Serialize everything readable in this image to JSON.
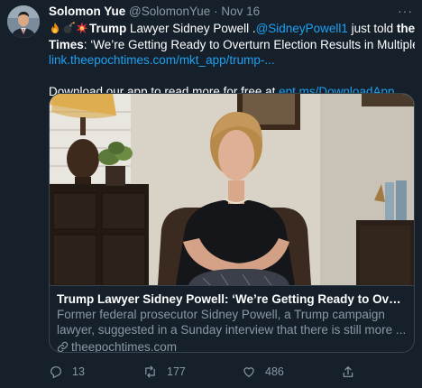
{
  "tweet": {
    "author_name": "Solomon Yue",
    "handle": "@SolomonYue",
    "separator": "·",
    "date": "Nov 16",
    "more_label": "···",
    "text": {
      "trump": "Trump",
      "lawyer": " Lawyer Sidney Powell .",
      "mention": "@SidneyPowell1",
      "just_told": " just told ",
      "epoch": "the Epoch",
      "times": "Times",
      "quote": ": ‘We’re Getting Ready to Overturn Election Results in Multiple States’",
      "link": "link.theepochtimes.com/mkt_app/trump-...",
      "download": "Download our app to read more for free at ",
      "download_link": "ept.ms/DownloadApp"
    },
    "card": {
      "title": "Trump Lawyer Sidney Powell: ‘We’re Getting Ready to Overturn Election ...",
      "description": "Former federal prosecutor Sidney Powell, a Trump campaign lawyer, suggested in a Sunday interview that there is still more ...",
      "domain": "theepochtimes.com"
    },
    "actions": {
      "replies": "13",
      "retweets": "177",
      "likes": "486"
    }
  },
  "colors": {
    "background": "#15202b",
    "link": "#1da1f2",
    "muted": "#8899a6",
    "border": "#38444d"
  },
  "icons": [
    "fire-icon",
    "bomb-icon",
    "explosion-icon",
    "link-icon",
    "reply-icon",
    "retweet-icon",
    "like-icon",
    "share-icon"
  ]
}
